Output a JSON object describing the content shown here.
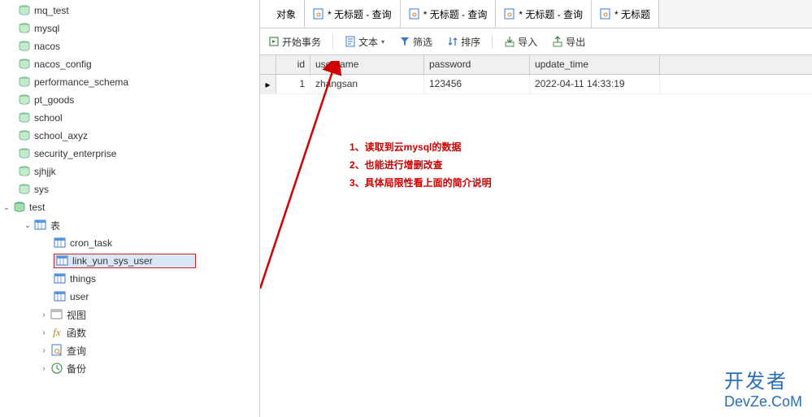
{
  "sidebar": {
    "databases": [
      {
        "name": "mq_test",
        "expand": ""
      },
      {
        "name": "mysql",
        "expand": ""
      },
      {
        "name": "nacos",
        "expand": ""
      },
      {
        "name": "nacos_config",
        "expand": ""
      },
      {
        "name": "performance_schema",
        "expand": ""
      },
      {
        "name": "pt_goods",
        "expand": ""
      },
      {
        "name": "school",
        "expand": ""
      },
      {
        "name": "school_axyz",
        "expand": ""
      },
      {
        "name": "security_enterprise",
        "expand": ""
      },
      {
        "name": "sjhjjk",
        "expand": ""
      },
      {
        "name": "sys",
        "expand": ""
      }
    ],
    "test_db": {
      "name": "test",
      "expand": "⌄"
    },
    "tables_folder": {
      "label": "表",
      "expand": "⌄"
    },
    "tables": [
      {
        "name": "cron_task"
      },
      {
        "name": "link_yun_sys_user",
        "selected": true
      },
      {
        "name": "things"
      },
      {
        "name": "user"
      }
    ],
    "groups": [
      {
        "label": "视图",
        "icon": "view"
      },
      {
        "label": "函数",
        "icon": "fx"
      },
      {
        "label": "查询",
        "icon": "query"
      },
      {
        "label": "备份",
        "icon": "backup"
      }
    ]
  },
  "tabs": [
    {
      "label": "对象",
      "first": true
    },
    {
      "label": "* 无标题 - 查询"
    },
    {
      "label": "* 无标题 - 查询"
    },
    {
      "label": "* 无标题 - 查询"
    },
    {
      "label": "* 无标题"
    }
  ],
  "toolbar": {
    "begin_tx": "开始事务",
    "text": "文本",
    "filter": "筛选",
    "sort": "排序",
    "import": "导入",
    "export": "导出"
  },
  "grid": {
    "columns": [
      "id",
      "username",
      "password",
      "update_time"
    ],
    "rows": [
      {
        "id": "1",
        "username": "zhangsan",
        "password": "123456",
        "update_time": "2022-04-11 14:33:19"
      }
    ]
  },
  "annotation": {
    "line1": "1、读取到云mysql的数据",
    "line2": "2、也能进行增删改查",
    "line3": "3、具体局限性看上面的简介说明"
  },
  "watermark": {
    "line1": "开发者",
    "line2": "DevZe.CoM"
  }
}
